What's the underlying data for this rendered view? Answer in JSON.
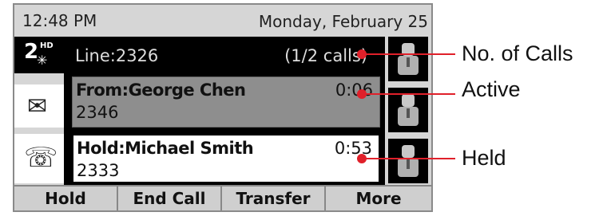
{
  "status_bar": {
    "time": "12:48 PM",
    "date": "Monday, February 25"
  },
  "line": {
    "label": "Line:2326",
    "calls": "(1/2 calls)"
  },
  "calls": [
    {
      "state": "active",
      "name": "From:George Chen",
      "number": "2346",
      "duration": "0:06"
    },
    {
      "state": "held",
      "name": "Hold:Michael Smith",
      "number": "2333",
      "duration": "0:53"
    }
  ],
  "softkeys": [
    "Hold",
    "End Call",
    "Transfer",
    "More"
  ],
  "callouts": {
    "calls": "No. of Calls",
    "active": "Active",
    "held": "Held"
  },
  "icons": {
    "hd": "hd-voice-icon",
    "mail": "envelope-icon",
    "directory": "directory-icon",
    "line_key": "contact-icon"
  },
  "hd_badge": {
    "two": "2",
    "hd": "HD"
  },
  "colors": {
    "callout": "#e0202a",
    "active_bg": "#8e8e8e",
    "held_bg": "#ffffff"
  }
}
